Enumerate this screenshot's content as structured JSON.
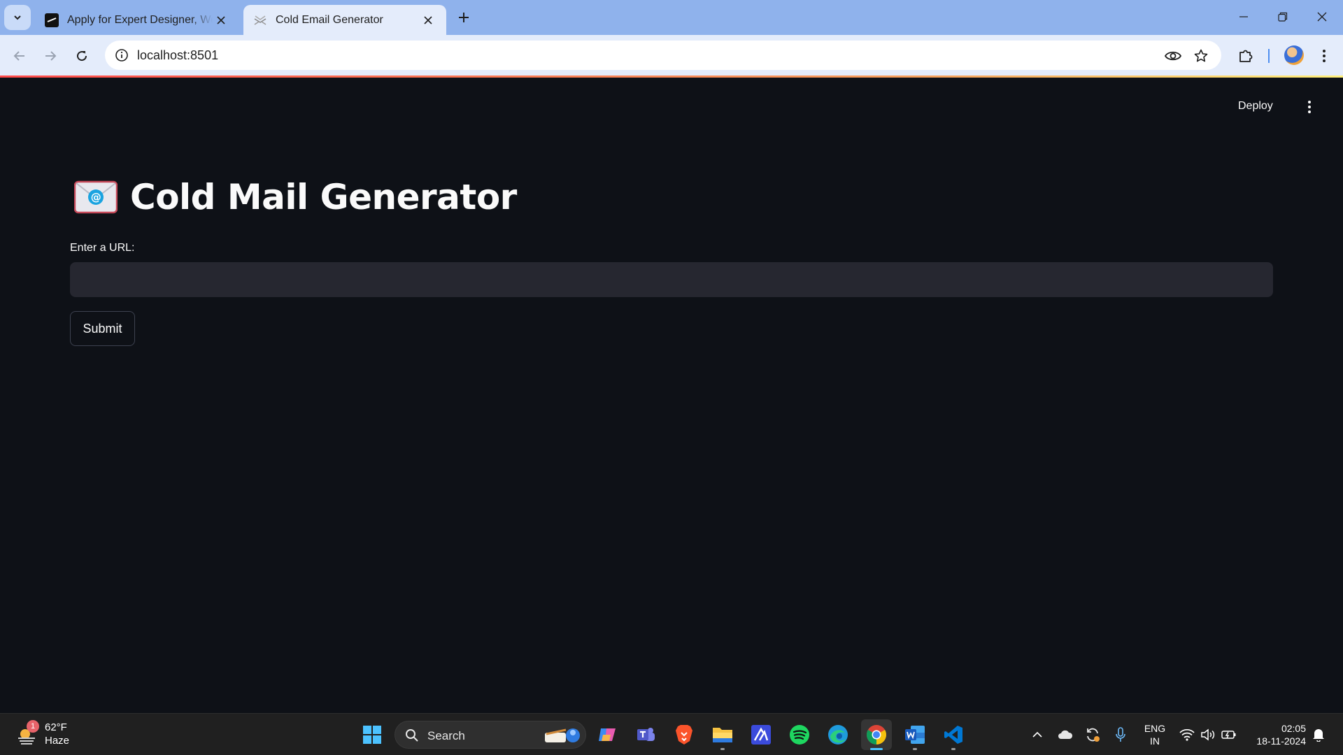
{
  "browser": {
    "tabs": [
      {
        "title": "Apply for Expert Designer, Work"
      },
      {
        "title": "Cold Email Generator"
      }
    ],
    "address": "localhost:8501"
  },
  "app": {
    "deploy_label": "Deploy",
    "title": "Cold Mail Generator",
    "input_label": "Enter a URL:",
    "input_value": "",
    "submit_label": "Submit"
  },
  "taskbar": {
    "weather": {
      "temp": "62°F",
      "condition": "Haze",
      "badge": "1"
    },
    "search_label": "Search",
    "language": {
      "line1": "ENG",
      "line2": "IN"
    },
    "time": "02:05",
    "date": "18-11-2024"
  },
  "colors": {
    "app_background": "#0e1117",
    "input_background": "#262730",
    "accent_line": "#ff4b4b",
    "tab_strip": "#8fb2ec"
  }
}
